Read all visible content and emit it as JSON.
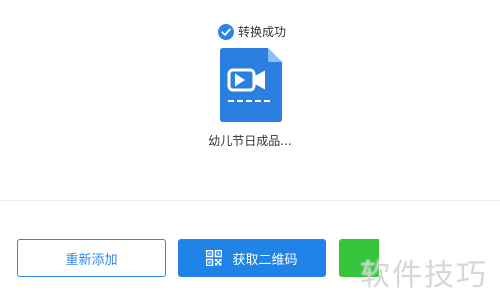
{
  "status": {
    "icon": "check-circle-icon",
    "text": "转换成功"
  },
  "file": {
    "icon": "video-file-icon",
    "name": "幼儿节日成品..."
  },
  "actions": {
    "readd_label": "重新添加",
    "qr_label": "获取二维码",
    "qr_icon": "qr-code-icon"
  },
  "watermark": {
    "text": "软件技巧"
  },
  "colors": {
    "accent": "#1f83e8",
    "outline": "#2b8ae8",
    "green": "#35c43c"
  }
}
